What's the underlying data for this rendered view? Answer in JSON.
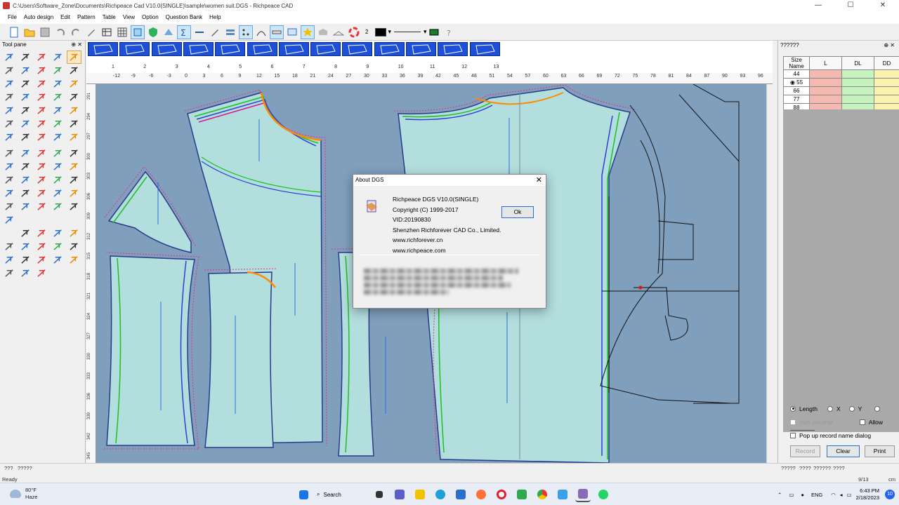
{
  "window": {
    "title": "C:\\Users\\Software_Zone\\Documents\\Richpeace Cad V10.0(SINGLE)\\sample\\women suit.DGS - Richpeace CAD",
    "min": "—",
    "max": "☐",
    "close": "✕"
  },
  "menu": [
    "File",
    "Auto design",
    "Edit",
    "Pattern",
    "Table",
    "View",
    "Option",
    "Question Bank",
    "Help"
  ],
  "toolbar": {
    "layer_number": "2"
  },
  "tool_pane": {
    "title": "Tool pane",
    "controls": "⊕ ✕"
  },
  "pieces": [
    "1",
    "2",
    "3",
    "4",
    "5",
    "6",
    "7",
    "8",
    "9",
    "10",
    "11",
    "12",
    "13"
  ],
  "ruler": {
    "h": [
      "-12",
      "-9",
      "-6",
      "-3",
      "0",
      "3",
      "6",
      "9",
      "12",
      "15",
      "18",
      "21",
      "24",
      "27",
      "30",
      "33",
      "36",
      "39",
      "42",
      "45",
      "48",
      "51",
      "54",
      "57",
      "60",
      "63",
      "66",
      "69",
      "72",
      "75",
      "78",
      "81",
      "84",
      "87",
      "90",
      "93",
      "96"
    ],
    "v": [
      "291",
      "294",
      "297",
      "300",
      "303",
      "306",
      "309",
      "312",
      "315",
      "318",
      "321",
      "324",
      "327",
      "330",
      "333",
      "336",
      "339",
      "342",
      "345"
    ]
  },
  "size_pane": {
    "title": "??????",
    "controls": "⊕ ✕",
    "columns": [
      "Size Name",
      "L",
      "DL",
      "DD"
    ],
    "sizes": [
      "44",
      "55",
      "66",
      "77",
      "88"
    ],
    "selected": "55",
    "options": {
      "length": "Length",
      "x": "X",
      "y": "Y",
      "inch_decimal": "Inch decimal",
      "allow": "Allow",
      "popup": "Pop up record name dialog"
    },
    "buttons": {
      "record": "Record",
      "clear": "Clear",
      "print": "Print"
    },
    "footer": [
      "?????",
      "????",
      "??????",
      "????"
    ]
  },
  "status": {
    "left_tabs": [
      "???",
      "?????"
    ],
    "ready": "Ready",
    "page": "9/13",
    "unit": "cm"
  },
  "about_dialog": {
    "title": "About DGS",
    "close": "✕",
    "lines": [
      "Richpeace DGS V10.0(SINGLE)",
      "Copyright (C) 1999-2017",
      "VID:20190830",
      "Shenzhen Richforever CAD Co., Limited.",
      "www.richforever.cn",
      "www.richpeace.com"
    ],
    "ok": "Ok"
  },
  "taskbar": {
    "temp": "80°F",
    "condition": "Haze",
    "search": "Search",
    "lang": "ENG",
    "time": "6:43 PM",
    "date": "2/18/2023",
    "notifications": "10",
    "tray_arrow": "⌃"
  },
  "colors": {
    "canvas": "#7f9fbd",
    "piece_fill": "#b3dede",
    "thumb_blue": "#1e4fd8",
    "size_L": "#f4b9b1",
    "size_DL": "#c6f2bd",
    "size_DD": "#fbf2b0"
  }
}
